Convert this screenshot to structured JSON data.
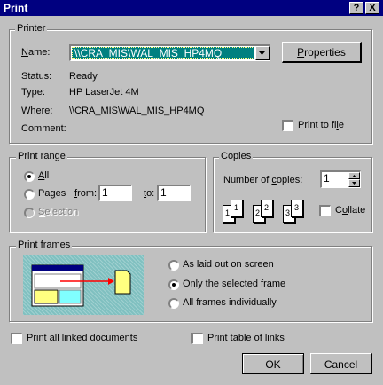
{
  "window": {
    "title": "Print",
    "help_label": "?",
    "close_label": "X"
  },
  "printer": {
    "group_label": "Printer",
    "name_label": "Name:",
    "name_value": "\\\\CRA_MIS\\WAL_MIS_HP4MQ",
    "properties_label": "Properties",
    "status_label": "Status:",
    "status_value": "Ready",
    "type_label": "Type:",
    "type_value": "HP LaserJet 4M",
    "where_label": "Where:",
    "where_value": "\\\\CRA_MIS\\WAL_MIS_HP4MQ",
    "comment_label": "Comment:",
    "print_to_file_label": "Print to file",
    "print_to_file_checked": false
  },
  "print_range": {
    "group_label": "Print range",
    "all_label": "All",
    "pages_label": "Pages",
    "from_label": "from:",
    "from_value": "1",
    "to_label": "to:",
    "to_value": "1",
    "selection_label": "Selection",
    "selected": "All"
  },
  "copies": {
    "group_label": "Copies",
    "number_label": "Number of copies:",
    "number_value": "1",
    "collate_label": "Collate",
    "collate_checked": false,
    "collate_page_numbers": [
      "1",
      "1",
      "2",
      "2",
      "3",
      "3"
    ]
  },
  "print_frames": {
    "group_label": "Print frames",
    "options": [
      "As laid out on screen",
      "Only the selected frame",
      "All frames individually"
    ],
    "selected": "Only the selected frame"
  },
  "options": {
    "linked_documents_label": "Print all linked documents",
    "linked_documents_checked": false,
    "table_of_links_label": "Print table of links",
    "table_of_links_checked": false
  },
  "buttons": {
    "ok_label": "OK",
    "cancel_label": "Cancel"
  },
  "colors": {
    "titlebar": "#000080",
    "face": "#c0c0c0",
    "selection_highlight": "#008080",
    "frames_preview_bg": "#80c0c0"
  }
}
